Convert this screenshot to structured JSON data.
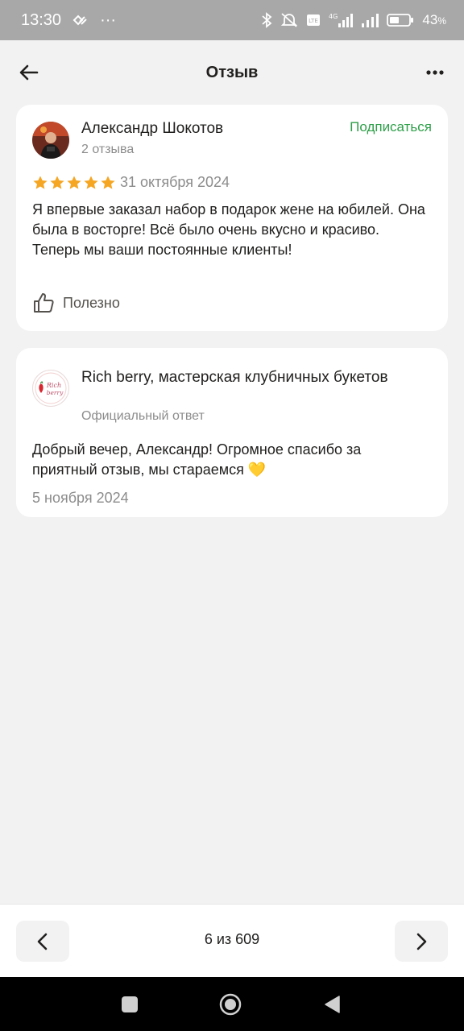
{
  "status_bar": {
    "time": "13:30",
    "dots": "···",
    "battery": "43",
    "battery_unit": "%"
  },
  "header": {
    "title": "Отзыв"
  },
  "review": {
    "author": "Александр Шокотов",
    "reviews_count": "2 отзыва",
    "subscribe_label": "Подписаться",
    "rating": 5,
    "date": "31 октября 2024",
    "text": "Я впервые заказал набор в подарок жене на юбилей. Она была в восторге! Всё было очень вкусно и красиво. Теперь мы ваши постоянные клиенты!",
    "useful_label": "Полезно"
  },
  "reply": {
    "company": "Rich berry, мастерская клубничных букетов",
    "official_label": "Официальный ответ",
    "text": "Добрый вечер, Александр! Огромное спасибо за приятный отзыв, мы стараемся 💛",
    "date": "5 ноября 2024",
    "logo_text": "Rich berry"
  },
  "pager": {
    "counter": "6 из 609"
  },
  "colors": {
    "accent_green": "#2d9f48",
    "star": "#f5a623",
    "background": "#f2f2f2"
  }
}
